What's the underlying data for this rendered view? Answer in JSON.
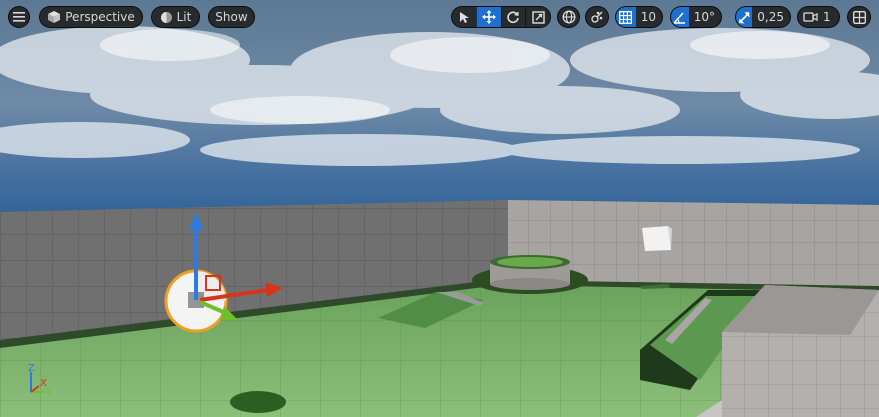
{
  "toolbar": {
    "view_mode": "Perspective",
    "lighting_mode": "Lit",
    "show_label": "Show",
    "grid_snap_value": "10",
    "rotation_snap_value": "10°",
    "scale_snap_value": "0,25",
    "camera_speed_value": "1"
  },
  "icons": {
    "menu": "hamburger-menu-icon",
    "perspective": "cube-icon",
    "lit": "sphere-icon",
    "select": "cursor-arrow-icon",
    "translate": "move-arrows-icon",
    "rotate": "rotate-icon",
    "scale": "scale-icon",
    "world_local": "globe-icon",
    "surface_snap": "surface-snap-icon",
    "grid_snap": "grid-icon",
    "rotation_snap": "angle-icon",
    "scale_snap": "scale-arrow-icon",
    "camera_speed": "camera-icon",
    "layout": "layout-grid-icon"
  },
  "axis_indicator": {
    "z_label": "Z",
    "x_label": "X",
    "y_label": "Y"
  },
  "colors": {
    "accent": "#1f6fd1",
    "gizmo_x": "#d8341c",
    "gizmo_y": "#6fbf2a",
    "gizmo_z": "#2d7be0",
    "selection": "#f0a020"
  }
}
